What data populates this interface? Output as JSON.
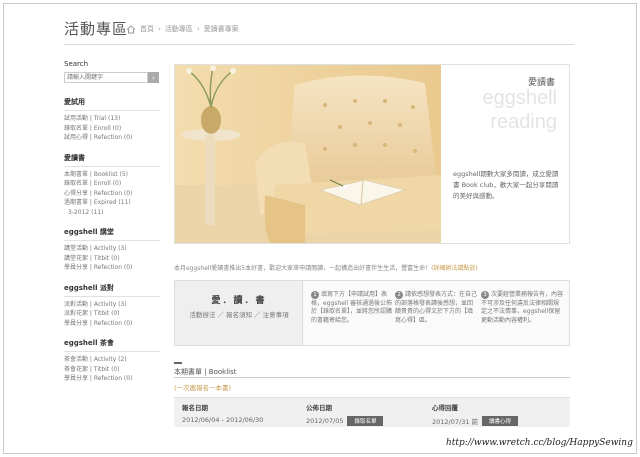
{
  "header": {
    "title": "活動專區",
    "crumbs": [
      "首頁",
      "活動專區",
      "愛讀書專案"
    ]
  },
  "sidebar": {
    "search_label": "Search",
    "search_placeholder": "請輸入關鍵字",
    "search_button": "›",
    "sections": [
      {
        "title": "愛試用",
        "items": [
          "試用活動 | Trial (13)",
          "錄取名單 | Enroll (0)",
          "試用心得 | Refection (0)"
        ]
      },
      {
        "title": "愛讀書",
        "items": [
          "本期書單 | Booklist (5)",
          "錄取名單 | Enroll (0)",
          "心得分享 | Refection (0)",
          "過期書單 | Expired (11)",
          "3-2012 (11)"
        ]
      },
      {
        "title": "eggshell 講堂",
        "items": [
          "講堂活動 | Activity (3)",
          "講堂花絮 | Titbit (0)",
          "學員分享 | Refection (0)"
        ]
      },
      {
        "title": "eggshell 派對",
        "items": [
          "派對活動 | Activity (3)",
          "派對花絮 | Titbit (0)",
          "學員分享 | Refection (0)"
        ]
      },
      {
        "title": "eggshell 茶會",
        "items": [
          "茶會活動 | Activity (2)",
          "茶會花絮 | Titbit (0)",
          "學員分享 | Refection (0)"
        ]
      }
    ]
  },
  "hero": {
    "title": "愛讀書",
    "en_line1": "eggshell",
    "en_line2": "reading",
    "desc": "eggshell期數大家多閱讀，成立愛讀書 Book club，歡大家一起分享閱讀的美好與感動。"
  },
  "intro": {
    "text": "本月eggshell愛讀書推出5本好書，歡迎大家來申請閱讀，一起構造出好書伴生生活，豐富生命！",
    "link": "(詳細辦法請點放)"
  },
  "steps": {
    "title": "愛．讀．書",
    "links": "活動辦法 ／ 報名須知 ／ 注意事項",
    "items": [
      {
        "num": "1",
        "text": "填寫下方【申請試用】表格，eggshell 審核通過後公佈於【錄取名單】，並將您所認購的書籍寄給您。"
      },
      {
        "num": "2",
        "text": "請依感想發表方式：在自己的部落格發表讀後感想，並回饋貴貴的心得文於下方的【填寫心得】區。"
      },
      {
        "num": "3",
        "text": "次要經營業務報告有，內容不可涉及任何違反法律相關規定之不法情事，eggshell保留更動活動內容權利。"
      }
    ]
  },
  "booklist": {
    "tab": "本期書單 | Booklist",
    "link": "(一次邀報名一本書)",
    "columns": [
      {
        "head": "報名日期",
        "value": "2012/06/04 - 2012/06/30",
        "button": ""
      },
      {
        "head": "公佈日期",
        "value": "2012/07/05",
        "button": "錄取名單"
      },
      {
        "head": "心得回覆",
        "value": "2012/07/31 前",
        "button": "讀書心得"
      }
    ]
  },
  "watermark": "http://www.wretch.cc/blog/HappySewing"
}
